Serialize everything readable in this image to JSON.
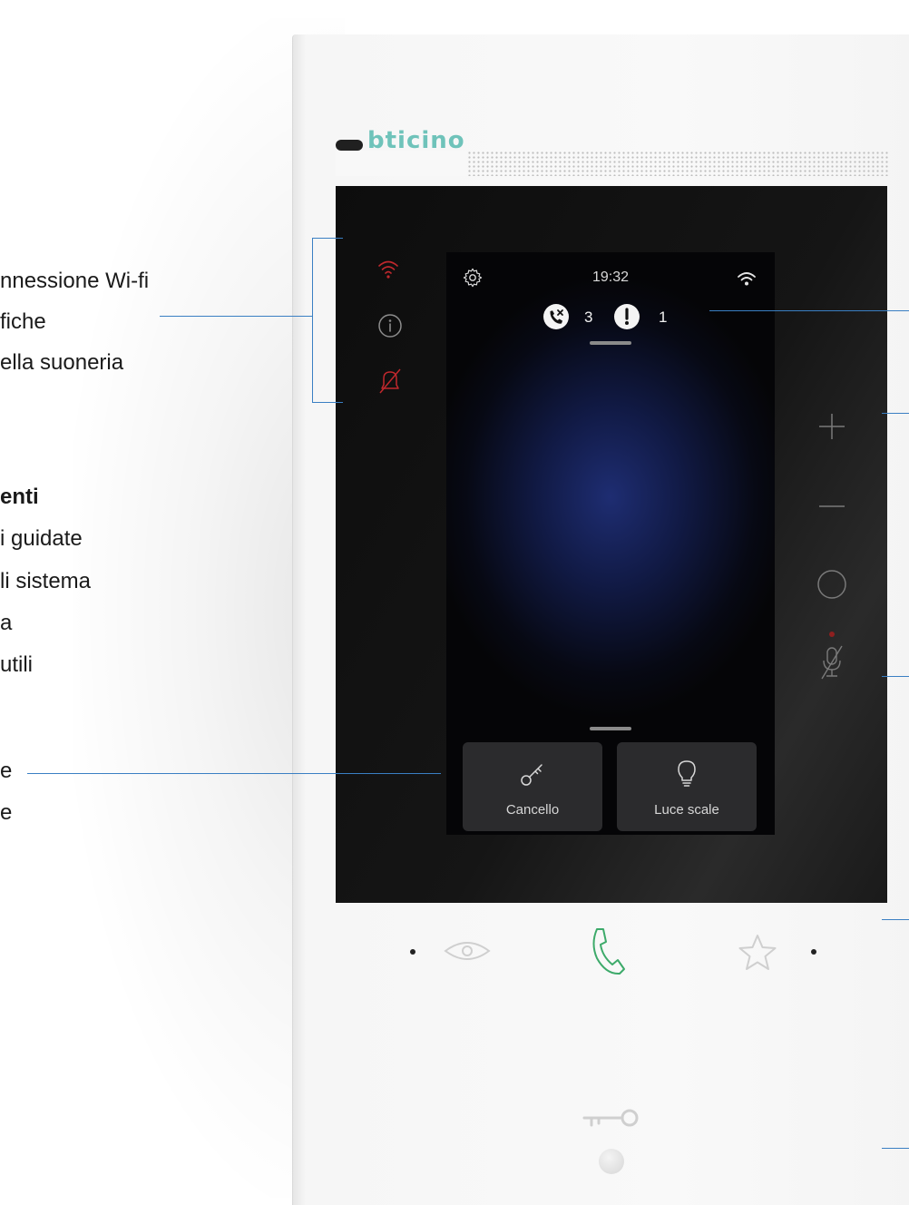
{
  "annotations": {
    "left": [
      "nnessione Wi-fi",
      "fiche",
      "ella suoneria",
      "enti",
      "i guidate",
      "li sistema",
      "a",
      "utili",
      "e",
      "e"
    ]
  },
  "device": {
    "brand": "bticino",
    "status_bar": {
      "time": "19:32",
      "missed_calls": "3",
      "alerts": "1"
    },
    "tiles": [
      {
        "label": "Cancello",
        "icon": "key-icon"
      },
      {
        "label": "Luce scale",
        "icon": "lightbulb-icon"
      }
    ],
    "side_indicators": [
      "wifi-icon",
      "info-icon",
      "bell-muted-icon"
    ],
    "side_buttons": [
      "plus-icon",
      "minus-icon",
      "circle-button-icon",
      "mic-muted-icon"
    ],
    "bottom_buttons": [
      "eye-icon",
      "phone-icon",
      "star-icon",
      "door-key-icon"
    ]
  },
  "colors": {
    "indicator_red": "#c0282d",
    "accent_green": "#3daa6a",
    "leader_blue": "#3a7fc3",
    "brand_teal": "#6fc3ba"
  }
}
